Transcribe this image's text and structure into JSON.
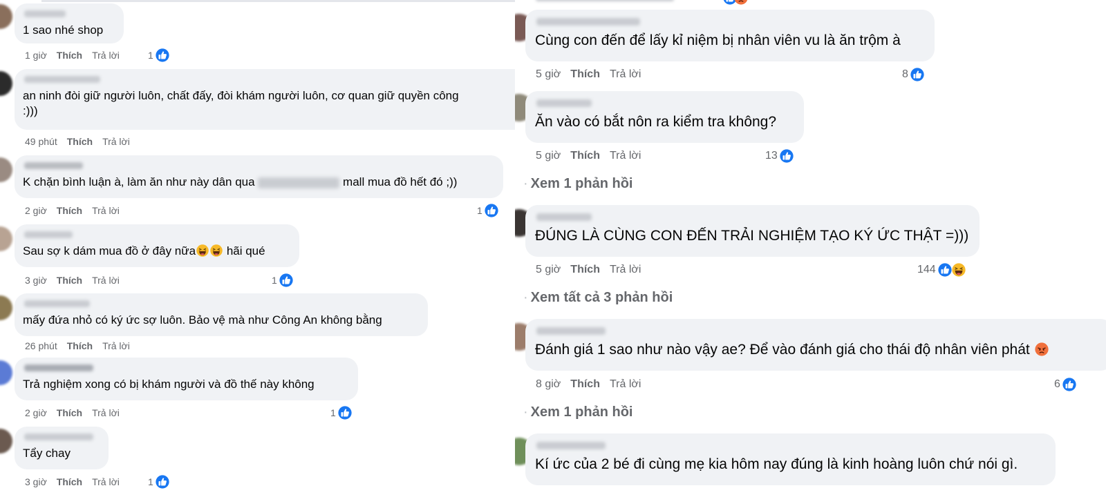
{
  "left": {
    "comments": [
      {
        "text": "1 sao nhé shop",
        "time": "1 giờ",
        "like": "Thích",
        "reply": "Trả lời",
        "reactions": "1"
      },
      {
        "text": "an ninh đòi giữ người luôn, chất đấy, đòi khám người luôn, cơ quan giữ quyền công",
        "text2": ":)))",
        "time": "49 phút",
        "like": "Thích",
        "reply": "Trả lời",
        "reactions": ""
      },
      {
        "text_a": "K chặn bình luận à, làm ăn như này dân qua",
        "text_b": "mall mua đồ hết đó ;))",
        "time": "2 giờ",
        "like": "Thích",
        "reply": "Trả lời",
        "reactions": "1"
      },
      {
        "text_a": "Sau sợ k dám mua đồ ở đây nữa",
        "text_b": "hãi qué",
        "time": "3 giờ",
        "like": "Thích",
        "reply": "Trả lời",
        "reactions": "1"
      },
      {
        "text": "mấy đứa nhỏ có ký ức sợ luôn. Bảo vệ mà như Công An không bằng",
        "time": "26 phút",
        "like": "Thích",
        "reply": "Trả lời",
        "reactions": ""
      },
      {
        "text": "Trả nghiệm xong có bị khám người và đồ thế này không",
        "time": "2 giờ",
        "like": "Thích",
        "reply": "Trả lời",
        "reactions": "1"
      },
      {
        "text": "Tẩy chay",
        "time": "3 giờ",
        "like": "Thích",
        "reply": "Trả lời",
        "reactions": "1"
      }
    ]
  },
  "right": {
    "comments": [
      {
        "text": "Cùng con đến để lấy kỉ niệm bị nhân viên vu là ăn trộm à",
        "time": "5 giờ",
        "like": "Thích",
        "reply": "Trả lời",
        "reactions": "8"
      },
      {
        "text": "Ăn vào có bắt nôn ra kiểm tra không?",
        "time": "5 giờ",
        "like": "Thích",
        "reply": "Trả lời",
        "reactions": "13"
      },
      {
        "text": "ĐÚNG LÀ CÙNG CON ĐẾN TRẢI NGHIỆM TẠO KÝ ỨC THẬT =)))",
        "time": "5 giờ",
        "like": "Thích",
        "reply": "Trả lời",
        "reactions": "144"
      },
      {
        "text": "Đánh giá 1 sao như nào vậy ae? Để vào đánh giá cho thái độ nhân viên phát",
        "time": "8 giờ",
        "like": "Thích",
        "reply": "Trả lời",
        "reactions": "6"
      },
      {
        "text": "Kí ức của 2 bé đi cùng mẹ kia hôm nay đúng là kinh hoàng luôn chứ nói gì."
      }
    ],
    "view_replies": [
      "Xem 1 phản hồi",
      "Xem tất cả 3 phản hồi",
      "Xem 1 phản hồi"
    ]
  },
  "colors": {
    "bubble": "#f0f2f5",
    "meta_text": "#65676b",
    "like_blue": "#1877f2",
    "text": "#050505"
  },
  "icons": {
    "like": "like-thumb-icon",
    "haha": "haha-emoji-icon",
    "angry": "angry-emoji-icon"
  }
}
